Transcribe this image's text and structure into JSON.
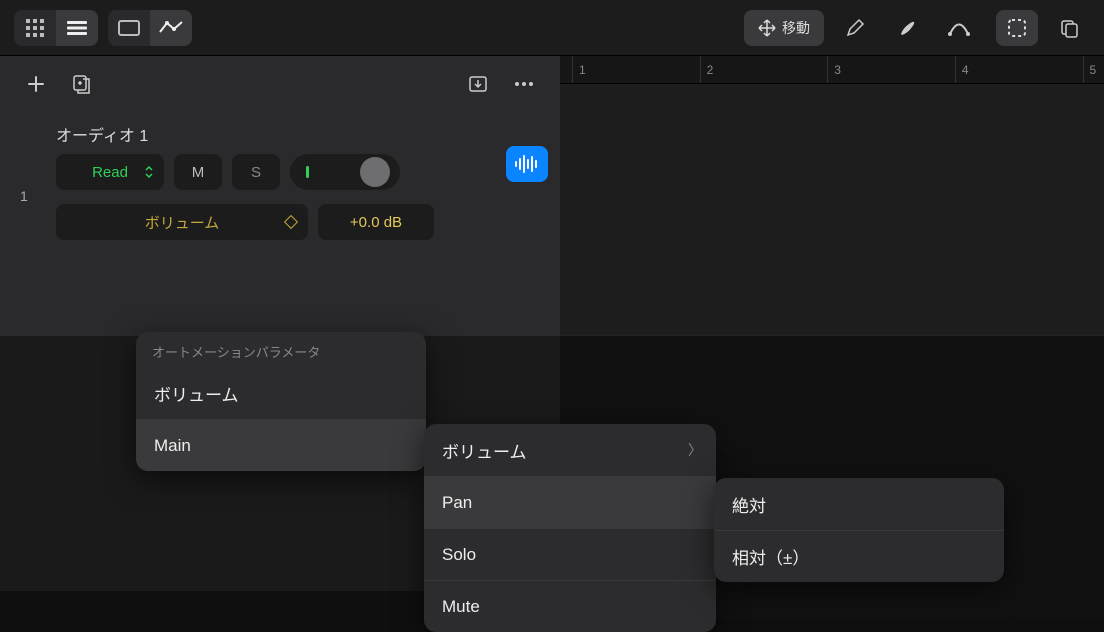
{
  "topbar": {
    "move_label": "移動"
  },
  "track_controls": {},
  "track": {
    "index": "1",
    "name": "オーディオ 1",
    "automation_mode": "Read",
    "mute_label": "M",
    "solo_label": "S",
    "param_name": "ボリューム",
    "param_value": "+0.0 dB"
  },
  "ruler": {
    "marks": [
      "1",
      "2",
      "3",
      "4",
      "5"
    ]
  },
  "popup1": {
    "header": "オートメーションパラメータ",
    "item_volume": "ボリューム",
    "item_main": "Main"
  },
  "popup2": {
    "item_volume": "ボリューム",
    "item_pan": "Pan",
    "item_solo": "Solo",
    "item_mute": "Mute"
  },
  "popup3": {
    "item_absolute": "絶対",
    "item_relative": "相対（±）"
  }
}
